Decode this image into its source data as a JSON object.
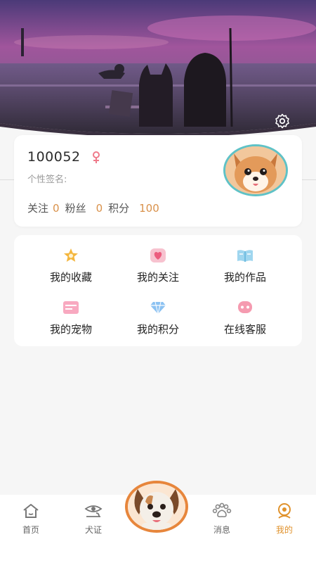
{
  "profile": {
    "user_id": "100052",
    "signature_label": "个性签名:",
    "follow_label": "关注",
    "follow_count": "0",
    "fans_label": "粉丝",
    "fans_count": "0",
    "points_label": "积分",
    "points_count": "100"
  },
  "menu": [
    {
      "label": "我的收藏",
      "icon": "star-icon"
    },
    {
      "label": "我的关注",
      "icon": "heart-icon"
    },
    {
      "label": "我的作品",
      "icon": "book-icon"
    },
    {
      "label": "我的宠物",
      "icon": "card-icon"
    },
    {
      "label": "我的积分",
      "icon": "diamond-icon"
    },
    {
      "label": "在线客服",
      "icon": "chat-icon"
    }
  ],
  "tabbar": {
    "home": "首页",
    "dog_license": "犬证",
    "messages": "消息",
    "mine": "我的",
    "active": "mine"
  },
  "colors": {
    "accent": "#e0922c",
    "number": "#d9914a",
    "avatar_border": "#5fc2c7",
    "center_border": "#e7863c"
  }
}
